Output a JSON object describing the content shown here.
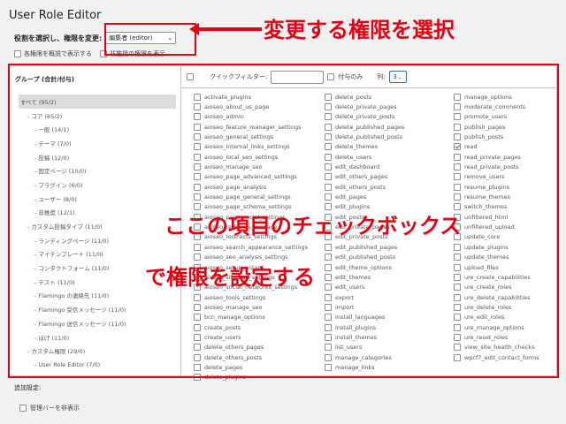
{
  "app_title": "User Role Editor",
  "role_select": {
    "label": "役割を選択し、権限を変更:",
    "value": "編集者 (editor)"
  },
  "options": {
    "show_deprecated_label": "各権限を概説で表示する",
    "show_extra_label": "非推奨の権限を表示"
  },
  "groups_header": "グループ (合計/付与)",
  "groups": [
    {
      "label": "すべて (95/2)",
      "selected": true,
      "level": 0
    },
    {
      "label": "- コア (65/2)",
      "selected": false,
      "level": 1
    },
    {
      "label": "- 一般 (14/1)",
      "selected": false,
      "level": 2
    },
    {
      "label": "- テーマ (7/0)",
      "selected": false,
      "level": 2
    },
    {
      "label": "- 投稿 (12/0)",
      "selected": false,
      "level": 2
    },
    {
      "label": "- 固定ページ (10/0)",
      "selected": false,
      "level": 2
    },
    {
      "label": "- プラグイン (6/0)",
      "selected": false,
      "level": 2
    },
    {
      "label": "- ユーザー (8/0)",
      "selected": false,
      "level": 2
    },
    {
      "label": "- 非推奨 (12/1)",
      "selected": false,
      "level": 2
    },
    {
      "label": "- カスタム投稿タイプ (11/0)",
      "selected": false,
      "level": 1
    },
    {
      "label": "- ランディングページ (11/0)",
      "selected": false,
      "level": 2
    },
    {
      "label": "- マイテンプレート (11/0)",
      "selected": false,
      "level": 2
    },
    {
      "label": "- コンタクトフォーム (11/0)",
      "selected": false,
      "level": 2
    },
    {
      "label": "- テスト (11/0)",
      "selected": false,
      "level": 2
    },
    {
      "label": "- Flamingo の連絡先 (11/0)",
      "selected": false,
      "level": 2
    },
    {
      "label": "- Flamingo 受信メッセージ (11/0)",
      "selected": false,
      "level": 2
    },
    {
      "label": "- Flamingo 送信メッセージ (11/0)",
      "selected": false,
      "level": 2
    },
    {
      "label": "- ほげ (11/0)",
      "selected": false,
      "level": 2
    },
    {
      "label": "- カスタム権限 (29/0)",
      "selected": false,
      "level": 1
    },
    {
      "label": "- User Role Editor (7/0)",
      "selected": false,
      "level": 2
    }
  ],
  "toolbar": {
    "quick_filter_label": "クイックフィルター:",
    "quick_filter_value": "",
    "granted_only_label": "付与のみ",
    "columns_label": "列:",
    "columns_value": "3"
  },
  "capabilities": [
    [
      {
        "name": "activate_plugins",
        "checked": false
      },
      {
        "name": "aioseo_about_us_page",
        "checked": false
      },
      {
        "name": "aioseo_admin",
        "checked": false
      },
      {
        "name": "aioseo_feature_manager_settings",
        "checked": false
      },
      {
        "name": "aioseo_general_settings",
        "checked": false
      },
      {
        "name": "aioseo_internal_links_settings",
        "checked": false
      },
      {
        "name": "aioseo_local_seo_settings",
        "checked": false
      },
      {
        "name": "aioseo_manage_seo",
        "checked": false
      },
      {
        "name": "aioseo_page_advanced_settings",
        "checked": false
      },
      {
        "name": "aioseo_page_analysis",
        "checked": false
      },
      {
        "name": "aioseo_page_general_settings",
        "checked": false
      },
      {
        "name": "aioseo_page_schema_settings",
        "checked": false
      },
      {
        "name": "aioseo_page_social_settings",
        "checked": false
      },
      {
        "name": "aioseo_redirects_manage",
        "checked": false
      },
      {
        "name": "aioseo_redirects_settings",
        "checked": false
      },
      {
        "name": "aioseo_search_appearance_settings",
        "checked": false
      },
      {
        "name": "aioseo_seo_analysis_settings",
        "checked": false
      },
      {
        "name": "aioseo_setup_wizard",
        "checked": false
      },
      {
        "name": "aioseo_sitemap_settings",
        "checked": false
      },
      {
        "name": "aioseo_social_networks_settings",
        "checked": false
      },
      {
        "name": "aioseo_tools_settings",
        "checked": false
      },
      {
        "name": "aioseo_manage_seo",
        "checked": false
      },
      {
        "name": "bcn_manage_options",
        "checked": false
      },
      {
        "name": "create_posts",
        "checked": false
      },
      {
        "name": "create_users",
        "checked": false
      },
      {
        "name": "delete_others_pages",
        "checked": false
      },
      {
        "name": "delete_others_posts",
        "checked": false
      },
      {
        "name": "delete_pages",
        "checked": false
      },
      {
        "name": "delete_plugins",
        "checked": false
      }
    ],
    [
      {
        "name": "delete_posts",
        "checked": false
      },
      {
        "name": "delete_private_pages",
        "checked": false
      },
      {
        "name": "delete_private_posts",
        "checked": false
      },
      {
        "name": "delete_published_pages",
        "checked": false
      },
      {
        "name": "delete_published_posts",
        "checked": false
      },
      {
        "name": "delete_themes",
        "checked": false
      },
      {
        "name": "delete_users",
        "checked": false
      },
      {
        "name": "edit_dashboard",
        "checked": false
      },
      {
        "name": "edit_others_pages",
        "checked": false
      },
      {
        "name": "edit_others_posts",
        "checked": false
      },
      {
        "name": "edit_pages",
        "checked": false
      },
      {
        "name": "edit_plugins",
        "checked": false
      },
      {
        "name": "edit_posts",
        "checked": false
      },
      {
        "name": "edit_private_pages",
        "checked": false
      },
      {
        "name": "edit_private_posts",
        "checked": false
      },
      {
        "name": "edit_published_pages",
        "checked": false
      },
      {
        "name": "edit_published_posts",
        "checked": false
      },
      {
        "name": "edit_theme_options",
        "checked": false
      },
      {
        "name": "edit_themes",
        "checked": false
      },
      {
        "name": "edit_users",
        "checked": false
      },
      {
        "name": "export",
        "checked": false
      },
      {
        "name": "import",
        "checked": false
      },
      {
        "name": "install_languages",
        "checked": false
      },
      {
        "name": "install_plugins",
        "checked": false
      },
      {
        "name": "install_themes",
        "checked": false
      },
      {
        "name": "list_users",
        "checked": false
      },
      {
        "name": "manage_categories",
        "checked": false
      },
      {
        "name": "manage_links",
        "checked": false
      }
    ],
    [
      {
        "name": "manage_options",
        "checked": false
      },
      {
        "name": "moderate_comments",
        "checked": false
      },
      {
        "name": "promote_users",
        "checked": false
      },
      {
        "name": "publish_pages",
        "checked": false
      },
      {
        "name": "publish_posts",
        "checked": false
      },
      {
        "name": "read",
        "checked": true
      },
      {
        "name": "read_private_pages",
        "checked": false
      },
      {
        "name": "read_private_posts",
        "checked": false
      },
      {
        "name": "remove_users",
        "checked": false
      },
      {
        "name": "resume_plugins",
        "checked": false
      },
      {
        "name": "resume_themes",
        "checked": false
      },
      {
        "name": "switch_themes",
        "checked": false
      },
      {
        "name": "unfiltered_html",
        "checked": false
      },
      {
        "name": "unfiltered_upload",
        "checked": false
      },
      {
        "name": "update_core",
        "checked": false
      },
      {
        "name": "update_plugins",
        "checked": false
      },
      {
        "name": "update_themes",
        "checked": false
      },
      {
        "name": "upload_files",
        "checked": false
      },
      {
        "name": "ure_create_capabilities",
        "checked": false
      },
      {
        "name": "ure_create_roles",
        "checked": false
      },
      {
        "name": "ure_delete_capabilities",
        "checked": false
      },
      {
        "name": "ure_delete_roles",
        "checked": false
      },
      {
        "name": "ure_edit_roles",
        "checked": false
      },
      {
        "name": "ure_manage_options",
        "checked": false
      },
      {
        "name": "ure_reset_roles",
        "checked": false
      },
      {
        "name": "view_site_health_checks",
        "checked": false
      },
      {
        "name": "wpcf7_edit_contact_forms",
        "checked": false
      }
    ]
  ],
  "extra": {
    "label": "追加設定:",
    "hide_admin_bar_label": "管理バーを非表示"
  },
  "annotations": {
    "select_role": "変更する権限を選択",
    "checkbox_line1": "ここの項目のチェックボックス",
    "checkbox_line2": "で権限を設定する"
  },
  "colors": {
    "annotation_red": "#e60012",
    "accent": "#2271b1"
  }
}
